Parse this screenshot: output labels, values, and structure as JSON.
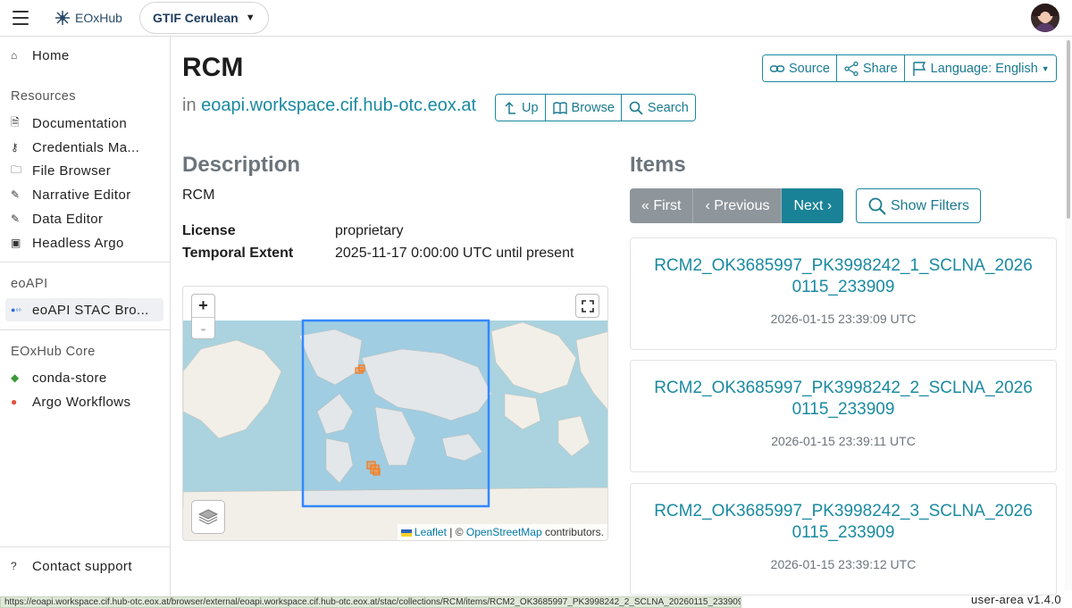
{
  "topbar": {
    "logo_text": "EOxHub",
    "workspace": "GTIF Cerulean"
  },
  "sidebar": {
    "home": "Home",
    "sections": [
      {
        "heading": "Resources",
        "items": [
          "Documentation",
          "Credentials Ma...",
          "File Browser",
          "Narrative Editor",
          "Data Editor",
          "Headless Argo"
        ]
      },
      {
        "heading": "eoAPI",
        "items": [
          "eoAPI STAC Bro..."
        ]
      },
      {
        "heading": "EOxHub Core",
        "items": [
          "conda-store",
          "Argo Workflows"
        ]
      }
    ],
    "contact": "Contact support"
  },
  "page": {
    "title": "RCM",
    "in_label": "in",
    "host": "eoapi.workspace.cif.hub-otc.eox.at",
    "nav_buttons": [
      "Up",
      "Browse",
      "Search"
    ],
    "top_buttons": [
      "Source",
      "Share",
      "Language: English"
    ]
  },
  "description": {
    "heading": "Description",
    "text": "RCM",
    "license_label": "License",
    "license_value": "proprietary",
    "extent_label": "Temporal Extent",
    "extent_value": "2025-11-17 0:00:00 UTC until present"
  },
  "map": {
    "zoom_in": "+",
    "zoom_out": "-",
    "attribution_leaflet": "Leaflet",
    "attribution_sep": " | © ",
    "attribution_osm": "OpenStreetMap",
    "attribution_tail": " contributors."
  },
  "items": {
    "heading": "Items",
    "pager": [
      "« First",
      "‹ Previous",
      "Next ›"
    ],
    "filters": "Show Filters",
    "list": [
      {
        "title_line1": "RCM2_OK3685997_PK3998242_1_SCLNA_2026",
        "title_line2": "0115_233909",
        "date": "2026-01-15 23:39:09 UTC"
      },
      {
        "title_line1": "RCM2_OK3685997_PK3998242_2_SCLNA_2026",
        "title_line2": "0115_233909",
        "date": "2026-01-15 23:39:11 UTC"
      },
      {
        "title_line1": "RCM2_OK3685997_PK3998242_3_SCLNA_2026",
        "title_line2": "0115_233909",
        "date": "2026-01-15 23:39:12 UTC"
      }
    ]
  },
  "status_url": "https://eoapi.workspace.cif.hub-otc.eox.at/browser/external/eoapi.workspace.cif.hub-otc.eox.at/stac/collections/RCM/items/RCM2_OK3685997_PK3998242_2_SCLNA_20260115_233909",
  "version": "user-area v1.4.0"
}
